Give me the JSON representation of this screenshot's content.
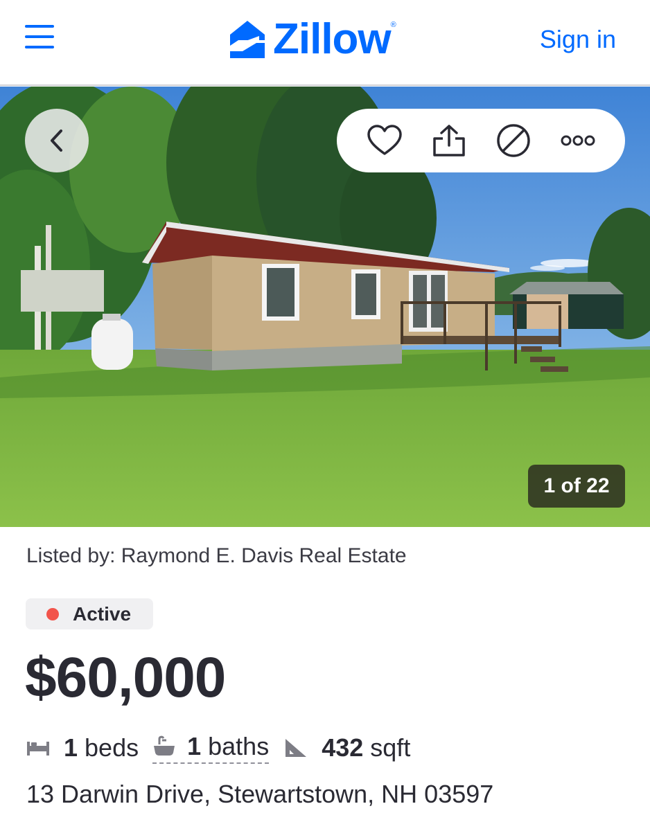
{
  "header": {
    "logo_text": "Zillow",
    "logo_reg": "®",
    "signin_label": "Sign in",
    "accent_color": "#006aff"
  },
  "photo": {
    "counter": "1 of 22",
    "icons": [
      "chevron-left-icon",
      "heart-icon",
      "share-icon",
      "hide-icon",
      "more-icon"
    ]
  },
  "listing": {
    "listed_by": "Listed by: Raymond E. Davis Real Estate",
    "status": "Active",
    "status_color": "#f2544b",
    "price": "$60,000",
    "beds_value": "1",
    "beds_label": "beds",
    "baths_value": "1",
    "baths_label": "baths",
    "sqft_value": "432",
    "sqft_label": "sqft",
    "address": "13 Darwin Drive, Stewartstown, NH 03597"
  }
}
